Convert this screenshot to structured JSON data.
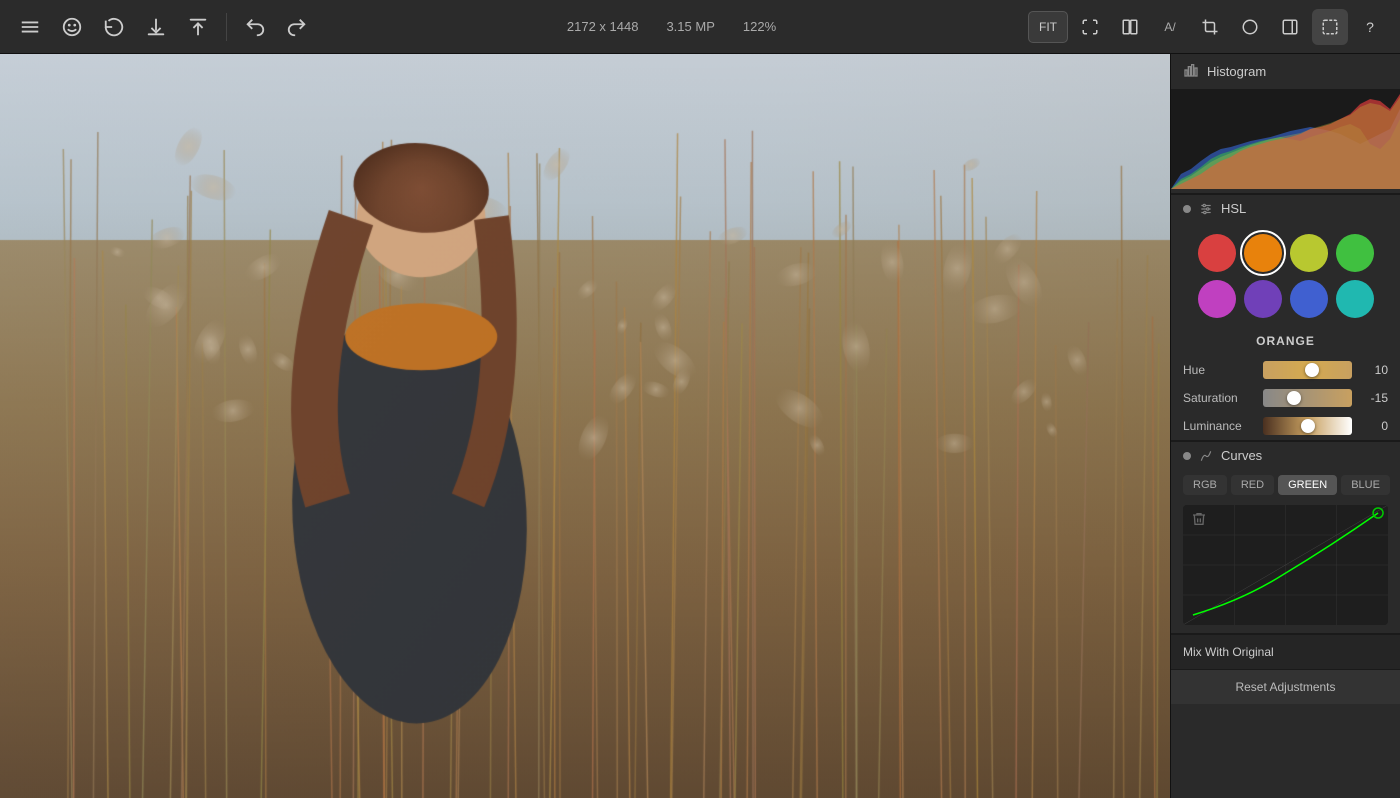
{
  "topbar": {
    "image_info": {
      "dimensions": "2172 x 1448",
      "megapixels": "3.15 MP",
      "zoom": "122%"
    },
    "fit_label": "FIT",
    "tools": [
      {
        "name": "menu",
        "icon": "≡"
      },
      {
        "name": "face-detect",
        "icon": "◎"
      },
      {
        "name": "history",
        "icon": "↺"
      },
      {
        "name": "download",
        "icon": "⬇"
      },
      {
        "name": "share",
        "icon": "⬆"
      },
      {
        "name": "undo",
        "icon": "←"
      },
      {
        "name": "redo",
        "icon": "→"
      }
    ],
    "right_tools": [
      {
        "name": "fit",
        "label": "FIT"
      },
      {
        "name": "fullscreen",
        "icon": "⛶"
      },
      {
        "name": "compare",
        "icon": "⬛"
      },
      {
        "name": "text-icon",
        "icon": "A/"
      },
      {
        "name": "crop",
        "icon": "⊡"
      },
      {
        "name": "circle-select",
        "icon": "○"
      },
      {
        "name": "panel",
        "icon": "▭"
      },
      {
        "name": "selection",
        "icon": "⬚"
      },
      {
        "name": "help",
        "icon": "?"
      }
    ]
  },
  "histogram": {
    "label": "Histogram"
  },
  "hsl": {
    "label": "HSL",
    "selected_color": "ORANGE",
    "colors": [
      {
        "name": "red",
        "color": "#d94040",
        "selected": false
      },
      {
        "name": "orange",
        "color": "#e8820c",
        "selected": true
      },
      {
        "name": "yellow-green",
        "color": "#b8c830",
        "selected": false
      },
      {
        "name": "green",
        "color": "#40c040",
        "selected": false
      },
      {
        "name": "magenta",
        "color": "#c040c0",
        "selected": false
      },
      {
        "name": "purple",
        "color": "#7040b8",
        "selected": false
      },
      {
        "name": "blue",
        "color": "#4060d0",
        "selected": false
      },
      {
        "name": "teal",
        "color": "#20b8b0",
        "selected": false
      }
    ],
    "sliders": {
      "hue": {
        "label": "Hue",
        "value": 10,
        "position": 0.55
      },
      "saturation": {
        "label": "Saturation",
        "value": -15,
        "position": 0.35
      },
      "luminance": {
        "label": "Luminance",
        "value": 0,
        "position": 0.5
      }
    }
  },
  "curves": {
    "label": "Curves",
    "tabs": [
      {
        "id": "rgb",
        "label": "RGB",
        "active": false
      },
      {
        "id": "red",
        "label": "RED",
        "active": false
      },
      {
        "id": "green",
        "label": "GREEN",
        "active": true
      },
      {
        "id": "blue",
        "label": "BLUE",
        "active": false
      }
    ]
  },
  "mix_with_original": {
    "label": "Mix With Original"
  },
  "reset": {
    "label": "Reset Adjustments"
  }
}
